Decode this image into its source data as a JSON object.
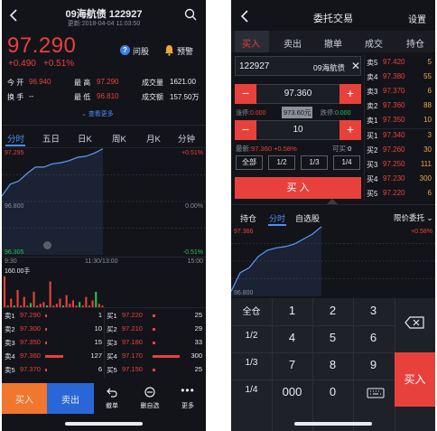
{
  "left": {
    "title": "09海航债 122927",
    "updated": "更新:2018-04-04 11:03:50",
    "price": "97.290",
    "change": "+0.490",
    "change_pct": "+0.51%",
    "ask_label": "问股",
    "alert_label": "预警",
    "stats": {
      "open_label": "今 开",
      "open_value": "96.940",
      "high_label": "最 高",
      "high_value": "97.290",
      "volume_label": "成交量",
      "volume_value": "1621.00",
      "turnover_label": "换 手",
      "turnover_value": "--",
      "low_label": "最 低",
      "low_value": "96.810",
      "amount_label": "成交额",
      "amount_value": "157.50万"
    },
    "view_more": "查看更多",
    "tabs": [
      "分时",
      "五日",
      "日K",
      "周K",
      "月K",
      "分钟"
    ],
    "active_tab": "分时",
    "chart": {
      "type": "line",
      "y_top": "97.295",
      "y_mid": "96.800",
      "y_bottom": "96.305",
      "pct_top": "+0.51%",
      "pct_mid": "0.00%",
      "pct_bottom": "-0.51%",
      "time_start": "9:30",
      "time_mid": "11:30/13:00",
      "time_end": "15:00",
      "volume_label": "160.00手",
      "x": [
        0,
        10,
        20,
        30,
        40,
        50,
        60,
        70,
        80,
        90,
        100,
        110,
        120
      ],
      "y": [
        96.85,
        96.96,
        96.99,
        97.06,
        97.12,
        97.12,
        97.15,
        97.16,
        97.18,
        97.21,
        97.22,
        97.25,
        97.29
      ],
      "volumes": [
        0.9,
        0.05,
        0.25,
        0.05,
        0.5,
        0.05,
        0.3,
        0.05,
        0.12,
        0.45,
        0.05,
        0.1,
        0.15,
        0.05,
        0.75,
        0.05,
        0.1,
        0.25,
        0.05,
        0.35,
        0.1,
        0.2,
        0.05,
        0.15,
        0.05,
        0.3,
        0.05,
        0.2,
        0.45,
        0.1,
        0.05
      ]
    },
    "asks": [
      {
        "label": "卖1",
        "price": "97.290",
        "qty": "1"
      },
      {
        "label": "卖2",
        "price": "97.300",
        "qty": "10"
      },
      {
        "label": "卖3",
        "price": "97.350",
        "qty": "15"
      },
      {
        "label": "卖4",
        "price": "97.360",
        "qty": "127"
      },
      {
        "label": "卖5",
        "price": "97.370",
        "qty": "6"
      }
    ],
    "bids": [
      {
        "label": "买1",
        "price": "97.220",
        "qty": "25"
      },
      {
        "label": "买2",
        "price": "97.210",
        "qty": "29"
      },
      {
        "label": "买3",
        "price": "97.180",
        "qty": "33"
      },
      {
        "label": "买4",
        "price": "97.170",
        "qty": "300"
      },
      {
        "label": "买5",
        "price": "97.150",
        "qty": "25"
      }
    ],
    "buttons": {
      "buy": "买入",
      "sell": "卖出",
      "cancel": "撤单",
      "remove": "删自选",
      "more": "更多"
    },
    "colors": {
      "buy": "#f0772d",
      "sell": "#2a67d6",
      "up": "#e8413c",
      "down": "#2bbf56"
    }
  },
  "right": {
    "title": "委托交易",
    "settings": "设置",
    "tabs": [
      "买入",
      "卖出",
      "撤单",
      "成交",
      "持仓"
    ],
    "active_tab": "买入",
    "code": "122927",
    "name": "09海航债",
    "price_value": "97.360",
    "limit_up_label": "涨停:",
    "limit_up_value": "0.000",
    "mid_value": "973.60元",
    "limit_down_label": "跌停:",
    "limit_down_value": "0.000",
    "qty_value": "10",
    "latest_label": "最新:",
    "latest_value": "97.360 +0.58%",
    "available_label": "可买:",
    "available_value": "0",
    "qty_buttons": [
      "全部",
      "1/2",
      "1/3",
      "1/4"
    ],
    "buy_button": "买 入",
    "asks": [
      {
        "label": "卖5",
        "price": "97.420",
        "qty": "5"
      },
      {
        "label": "卖4",
        "price": "97.380",
        "qty": "55"
      },
      {
        "label": "卖3",
        "price": "97.370",
        "qty": "6"
      },
      {
        "label": "卖2",
        "price": "97.360",
        "qty": "88"
      },
      {
        "label": "卖1",
        "price": "97.350",
        "qty": "10"
      }
    ],
    "bids": [
      {
        "label": "买1",
        "price": "97.340",
        "qty": "3"
      },
      {
        "label": "买2",
        "price": "97.260",
        "qty": "30"
      },
      {
        "label": "买3",
        "price": "97.250",
        "qty": "111"
      },
      {
        "label": "买4",
        "price": "97.230",
        "qty": "300"
      },
      {
        "label": "买5",
        "price": "97.220",
        "qty": "6"
      }
    ],
    "lower_tabs": [
      "持仓",
      "分时",
      "自选股"
    ],
    "active_lower_tab": "分时",
    "order_type": "限价委托",
    "chart": {
      "type": "line",
      "y_top": "97.366",
      "y_bottom": "96.800",
      "pct_top": "+0.58%",
      "x": [
        0,
        10,
        20,
        30,
        40,
        50,
        60,
        70,
        80,
        90,
        100
      ],
      "y": [
        96.84,
        96.99,
        97.03,
        97.12,
        97.17,
        97.19,
        97.2,
        97.22,
        97.26,
        97.3,
        97.36
      ]
    },
    "keypad": {
      "row1": [
        "全仓",
        "1",
        "2",
        "3"
      ],
      "row2": [
        "1/2",
        "4",
        "5",
        "6"
      ],
      "row3": [
        "1/3",
        "7",
        "8",
        "9"
      ],
      "row4": [
        "1/4",
        "000",
        "0"
      ],
      "buy": "买入"
    }
  }
}
